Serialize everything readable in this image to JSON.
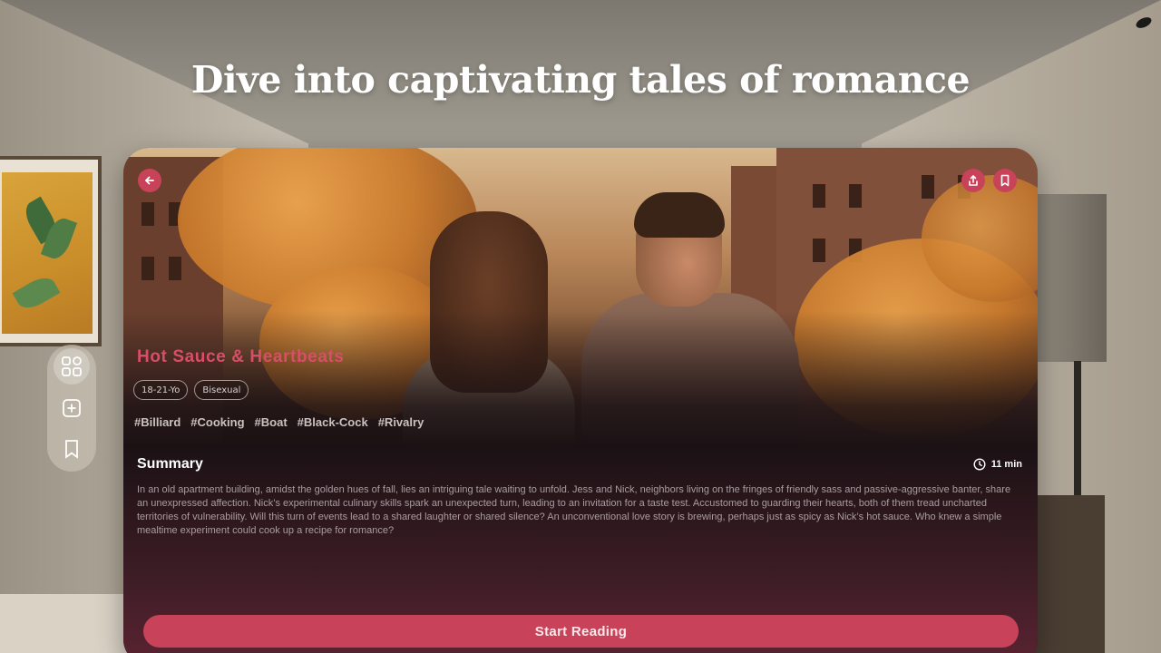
{
  "headline": "Dive into captivating tales of romance",
  "story": {
    "title": "Hot Sauce & Heartbeats",
    "tags": [
      "18-21-Yo",
      "Bisexual"
    ],
    "hashtags": [
      "#Billiard",
      "#Cooking",
      "#Boat",
      "#Black-Cock",
      "#Rivalry"
    ],
    "summary_label": "Summary",
    "duration": "11 min",
    "summary": "In an old apartment building, amidst the golden hues of fall, lies an intriguing tale waiting to unfold. Jess and Nick, neighbors living on the fringes of friendly sass and passive-aggressive banter, share an unexpressed affection. Nick’s experimental culinary skills spark an unexpected turn, leading to an invitation for a taste test. Accustomed to guarding their hearts, both of them tread uncharted territories of vulnerability. Will this turn of events lead to a shared laughter or shared silence? An unconventional love story is brewing, perhaps just as spicy as Nick’s hot sauce. Who knew a simple mealtime experiment could cook up a recipe for romance?",
    "start_label": "Start Reading"
  },
  "toolbar": {
    "items": [
      {
        "icon": "grid-icon",
        "active": true
      },
      {
        "icon": "add-square-icon",
        "active": false
      },
      {
        "icon": "bookmark-icon",
        "active": false
      }
    ]
  },
  "colors": {
    "accent": "#c8435a",
    "title": "#d94d68",
    "card_bg": "#1b1114"
  }
}
